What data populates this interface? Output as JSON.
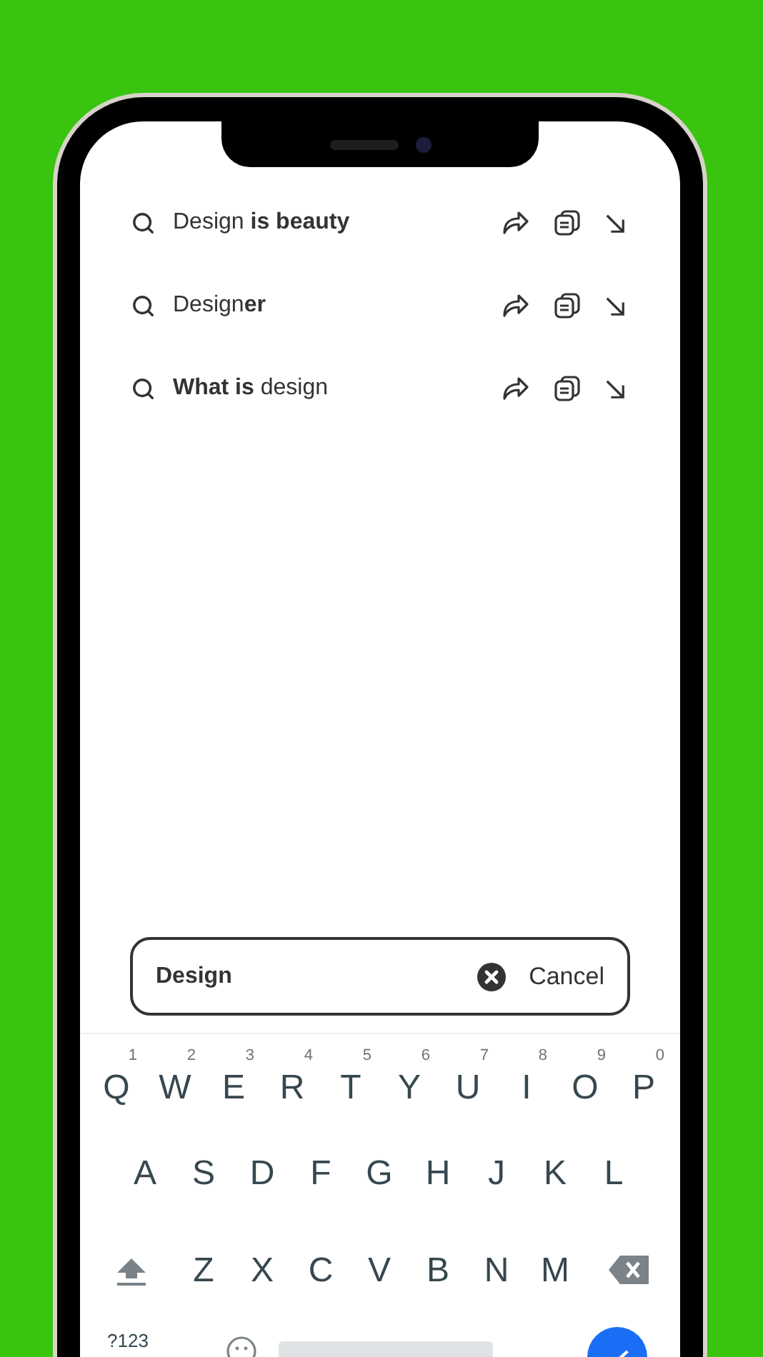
{
  "suggestions": [
    {
      "text": "Design **is beauty**"
    },
    {
      "text": "Design**er**"
    },
    {
      "text": "**What is** design"
    }
  ],
  "search": {
    "value": "Design",
    "cancel": "Cancel"
  },
  "keyboard": {
    "rows": [
      [
        {
          "label": "Q",
          "hint": "1"
        },
        {
          "label": "W",
          "hint": "2"
        },
        {
          "label": "E",
          "hint": "3"
        },
        {
          "label": "R",
          "hint": "4"
        },
        {
          "label": "T",
          "hint": "5"
        },
        {
          "label": "Y",
          "hint": "6"
        },
        {
          "label": "U",
          "hint": "7"
        },
        {
          "label": "I",
          "hint": "8"
        },
        {
          "label": "O",
          "hint": "9"
        },
        {
          "label": "P",
          "hint": "0"
        }
      ],
      [
        {
          "label": "A"
        },
        {
          "label": "S"
        },
        {
          "label": "D"
        },
        {
          "label": "F"
        },
        {
          "label": "G"
        },
        {
          "label": "H"
        },
        {
          "label": "J"
        },
        {
          "label": "K"
        },
        {
          "label": "L"
        }
      ],
      [
        {
          "kind": "shift"
        },
        {
          "label": "Z"
        },
        {
          "label": "X"
        },
        {
          "label": "C"
        },
        {
          "label": "V"
        },
        {
          "label": "B"
        },
        {
          "label": "N"
        },
        {
          "label": "M"
        },
        {
          "kind": "backspace"
        }
      ]
    ],
    "bottom_row": [
      {
        "kind": "symbols",
        "label": "?123"
      },
      {
        "kind": "emoji"
      },
      {
        "kind": "space"
      },
      {
        "kind": "enter"
      }
    ]
  }
}
